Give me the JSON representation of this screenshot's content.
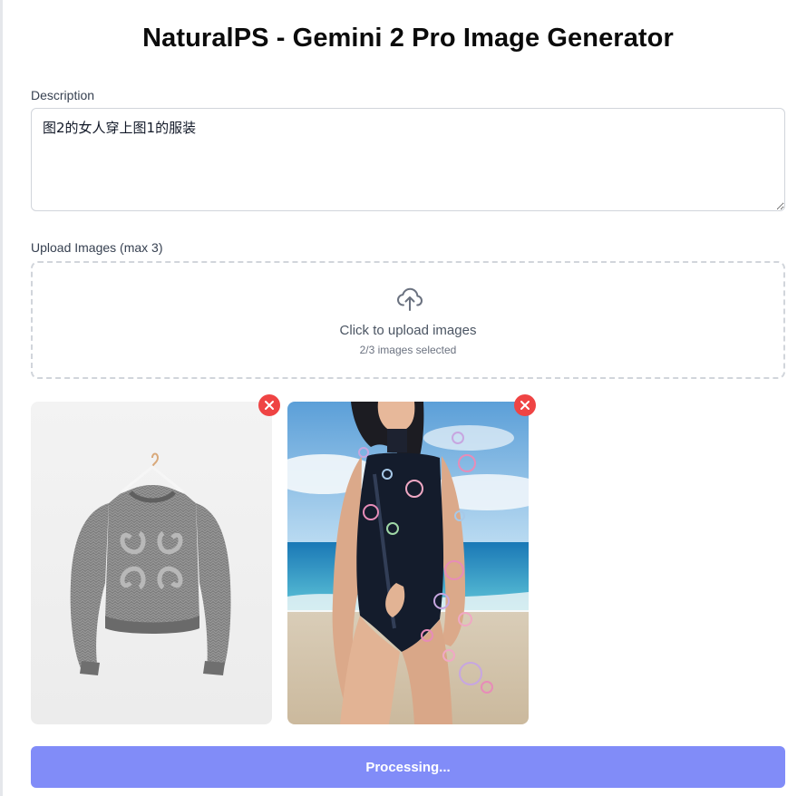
{
  "app": {
    "title": "NaturalPS - Gemini 2 Pro Image Generator"
  },
  "description": {
    "label": "Description",
    "value": "图2的女人穿上图1的服装"
  },
  "upload": {
    "label": "Upload Images (max 3)",
    "prompt": "Click to upload images",
    "status": "2/3 images selected",
    "icon": "cloud-upload-icon"
  },
  "previews": [
    {
      "name": "image-1",
      "subject": "grey knit sweater on hanger"
    },
    {
      "name": "image-2",
      "subject": "woman in swimsuit on beach with bubbles"
    }
  ],
  "submit": {
    "label": "Processing..."
  },
  "colors": {
    "accent": "#818cf8",
    "remove": "#ef4444"
  }
}
